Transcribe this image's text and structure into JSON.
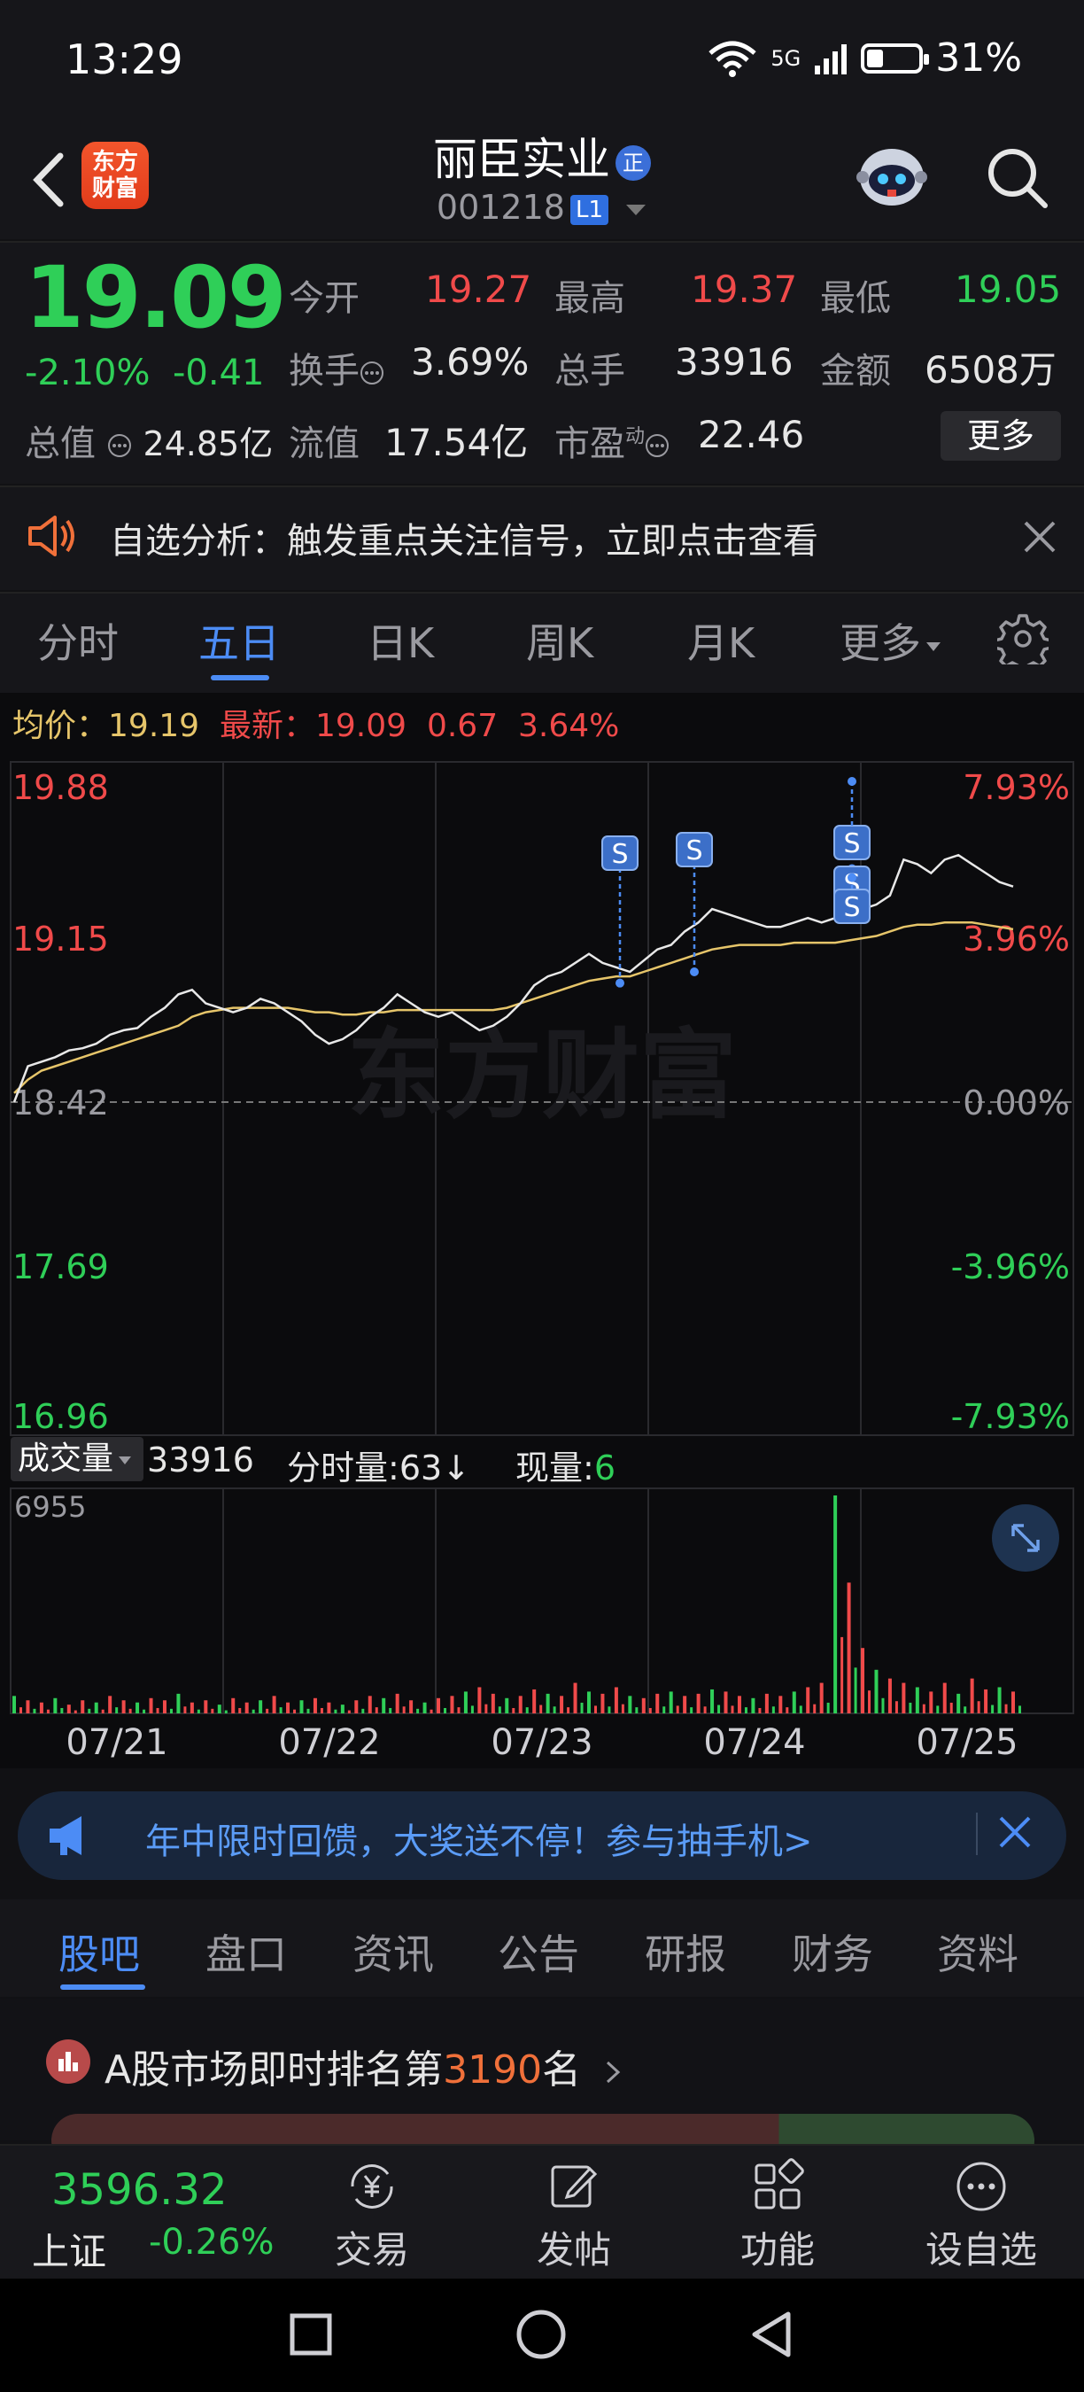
{
  "status_bar": {
    "time": "13:29",
    "network": "5G",
    "battery": "31%"
  },
  "header": {
    "title": "丽臣实业",
    "badge": "正",
    "code": "001218",
    "level": "L1",
    "logo_text": "东方财富"
  },
  "quote": {
    "price": "19.09",
    "change_pct": "-2.10%",
    "change_abs": "-0.41",
    "total_value_label": "总值",
    "total_value": "24.85亿",
    "open_label": "今开",
    "open": "19.27",
    "high_label": "最高",
    "high": "19.37",
    "low_label": "最低",
    "low": "19.05",
    "turnover_label": "换手",
    "turnover": "3.69%",
    "volume_label": "总手",
    "volume": "33916",
    "amount_label": "金额",
    "amount": "6508万",
    "float_label": "流值",
    "float_value": "17.54亿",
    "pe_label": "市盈",
    "pe_sup": "动",
    "pe": "22.46",
    "more_label": "更多"
  },
  "notice": {
    "text": "自选分析：触发重点关注信号，立即点击查看"
  },
  "chart_tabs": [
    {
      "label": "分时"
    },
    {
      "label": "五日"
    },
    {
      "label": "日K"
    },
    {
      "label": "周K"
    },
    {
      "label": "月K"
    },
    {
      "label": "更多"
    }
  ],
  "chart_header": {
    "avg_label": "均价：",
    "avg": "19.19",
    "latest_label": "最新：",
    "latest": "19.09",
    "latest_chg": "0.67",
    "latest_pct": "3.64%"
  },
  "chart_data": {
    "type": "line",
    "title": "",
    "x_labels": [
      "07/21",
      "07/22",
      "07/23",
      "07/24",
      "07/25"
    ],
    "y_left_ticks": [
      "19.88",
      "19.15",
      "18.42",
      "17.69",
      "16.96"
    ],
    "y_right_ticks": [
      "7.93%",
      "3.96%",
      "0.00%",
      "-3.96%",
      "-7.93%"
    ],
    "ylim": [
      16.96,
      19.88
    ],
    "prev_close": 18.42,
    "signal_marker": "S",
    "series": [
      {
        "name": "",
        "values": [
          18.42,
          18.58,
          18.6,
          18.62,
          18.65,
          18.66,
          18.68,
          18.72,
          18.74,
          18.75,
          18.8,
          18.84,
          18.9,
          18.92,
          18.86,
          18.84,
          18.82,
          18.84,
          18.88,
          18.86,
          18.82,
          18.78,
          18.72,
          18.68,
          18.7,
          18.74,
          18.8,
          18.84,
          18.9,
          18.86,
          18.82,
          18.8,
          18.82,
          18.78,
          18.74,
          18.76,
          18.8,
          18.86,
          18.94,
          18.98,
          19.0,
          19.04,
          19.08,
          19.04,
          19.02,
          19.0,
          19.05,
          19.1,
          19.12,
          19.18,
          19.22,
          19.28,
          19.26,
          19.24,
          19.22,
          19.2,
          19.2,
          19.22,
          19.24,
          19.22,
          19.24,
          19.26,
          19.28,
          19.3,
          19.34,
          19.5,
          19.48,
          19.44,
          19.5,
          19.52,
          19.48,
          19.44,
          19.4,
          19.38
        ]
      },
      {
        "name": "",
        "values": [
          18.46,
          18.52,
          18.56,
          18.58,
          18.6,
          18.62,
          18.64,
          18.66,
          18.68,
          18.7,
          18.72,
          18.74,
          18.76,
          18.8,
          18.82,
          18.83,
          18.84,
          18.84,
          18.84,
          18.84,
          18.84,
          18.83,
          18.82,
          18.82,
          18.81,
          18.81,
          18.82,
          18.82,
          18.83,
          18.83,
          18.83,
          18.83,
          18.83,
          18.83,
          18.83,
          18.83,
          18.84,
          18.86,
          18.88,
          18.9,
          18.92,
          18.94,
          18.96,
          18.97,
          18.98,
          18.98,
          19.0,
          19.02,
          19.04,
          19.06,
          19.08,
          19.1,
          19.11,
          19.12,
          19.12,
          19.12,
          19.12,
          19.13,
          19.13,
          19.13,
          19.13,
          19.14,
          19.15,
          19.16,
          19.18,
          19.2,
          19.21,
          19.21,
          19.22,
          19.22,
          19.22,
          19.21,
          19.2,
          19.19
        ]
      }
    ],
    "volume_values": [
      8,
      6,
      5,
      7,
      4,
      6,
      5,
      8,
      6,
      5,
      7,
      6,
      9,
      5,
      6,
      4,
      7,
      5,
      6,
      8,
      5,
      6,
      7,
      5,
      4,
      6,
      8,
      7,
      9,
      6,
      5,
      7,
      8,
      10,
      12,
      9,
      7,
      8,
      11,
      9,
      8,
      14,
      10,
      9,
      12,
      8,
      7,
      9,
      10,
      8,
      9,
      11,
      10,
      8,
      7,
      9,
      8,
      10,
      12,
      14,
      100,
      60,
      30,
      20,
      16,
      14,
      12,
      10,
      14,
      9,
      16,
      11,
      12,
      10
    ],
    "volume_ymax": 6955
  },
  "volume_header": {
    "selector": "成交量",
    "total": "33916",
    "tick_label": "分时量:",
    "tick": "63",
    "now_label": "现量:",
    "now": "6",
    "ymax": "6955"
  },
  "promo": {
    "text": "年中限时回馈，大奖送不停！参与抽手机>"
  },
  "bottom_tabs": [
    {
      "label": "股吧"
    },
    {
      "label": "盘口"
    },
    {
      "label": "资讯"
    },
    {
      "label": "公告"
    },
    {
      "label": "研报"
    },
    {
      "label": "财务"
    },
    {
      "label": "资料"
    }
  ],
  "ranking": {
    "prefix": "A股市场即时排名第",
    "rank": "3190",
    "suffix": "名"
  },
  "bottom_bar": {
    "index_value": "3596.32",
    "index_name": "上证",
    "index_change": "-0.26%",
    "items": [
      {
        "label": "交易"
      },
      {
        "label": "发帖"
      },
      {
        "label": "功能"
      },
      {
        "label": "设自选"
      }
    ]
  },
  "watermark": "东方财富",
  "colors": {
    "up": "#f04a4a",
    "down": "#2fcf58",
    "accent": "#4c8cf5",
    "price_line": "#e8e8e8",
    "avg_line": "#e6c56a"
  }
}
